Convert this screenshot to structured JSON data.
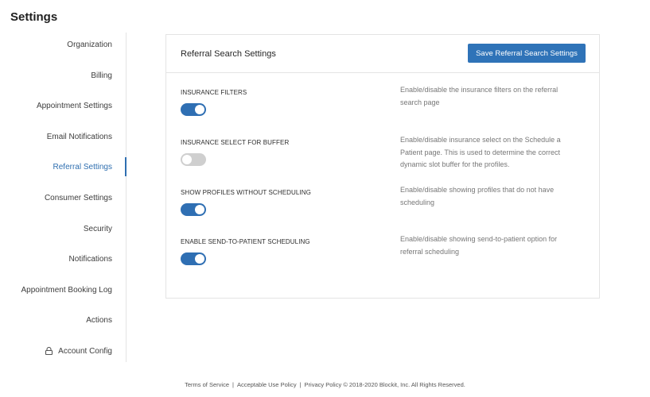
{
  "page": {
    "title": "Settings"
  },
  "sidebar": {
    "items": [
      {
        "label": "Organization"
      },
      {
        "label": "Billing"
      },
      {
        "label": "Appointment Settings"
      },
      {
        "label": "Email Notifications"
      },
      {
        "label": "Referral Settings",
        "active": true
      },
      {
        "label": "Consumer Settings"
      },
      {
        "label": "Security"
      },
      {
        "label": "Notifications"
      },
      {
        "label": "Appointment Booking Log"
      },
      {
        "label": "Actions"
      },
      {
        "label": "Account Config",
        "icon": "lock-icon"
      }
    ]
  },
  "panel": {
    "title": "Referral Search Settings",
    "save_label": "Save Referral Search Settings",
    "settings": [
      {
        "label": "INSURANCE FILTERS",
        "enabled": true,
        "description": "Enable/disable the insurance filters on the referral search page"
      },
      {
        "label": "INSURANCE SELECT FOR BUFFER",
        "enabled": false,
        "description": "Enable/disable insurance select on the Schedule a Patient page. This is used to determine the correct dynamic slot buffer for the profiles."
      },
      {
        "label": "SHOW PROFILES WITHOUT SCHEDULING",
        "enabled": true,
        "description": "Enable/disable showing profiles that do not have scheduling"
      },
      {
        "label": "ENABLE SEND-TO-PATIENT SCHEDULING",
        "enabled": true,
        "description": "Enable/disable showing send-to-patient option for referral scheduling"
      }
    ]
  },
  "footer": {
    "links": [
      "Terms of Service",
      "Acceptable Use Policy",
      "Privacy Policy"
    ],
    "separator": "|",
    "copyright": "© 2018-2020 Blockit, Inc. All Rights Reserved."
  },
  "colors": {
    "accent": "#2f73b8",
    "toggle_on": "#2f6fb3",
    "toggle_off": "#cfcfcf"
  }
}
